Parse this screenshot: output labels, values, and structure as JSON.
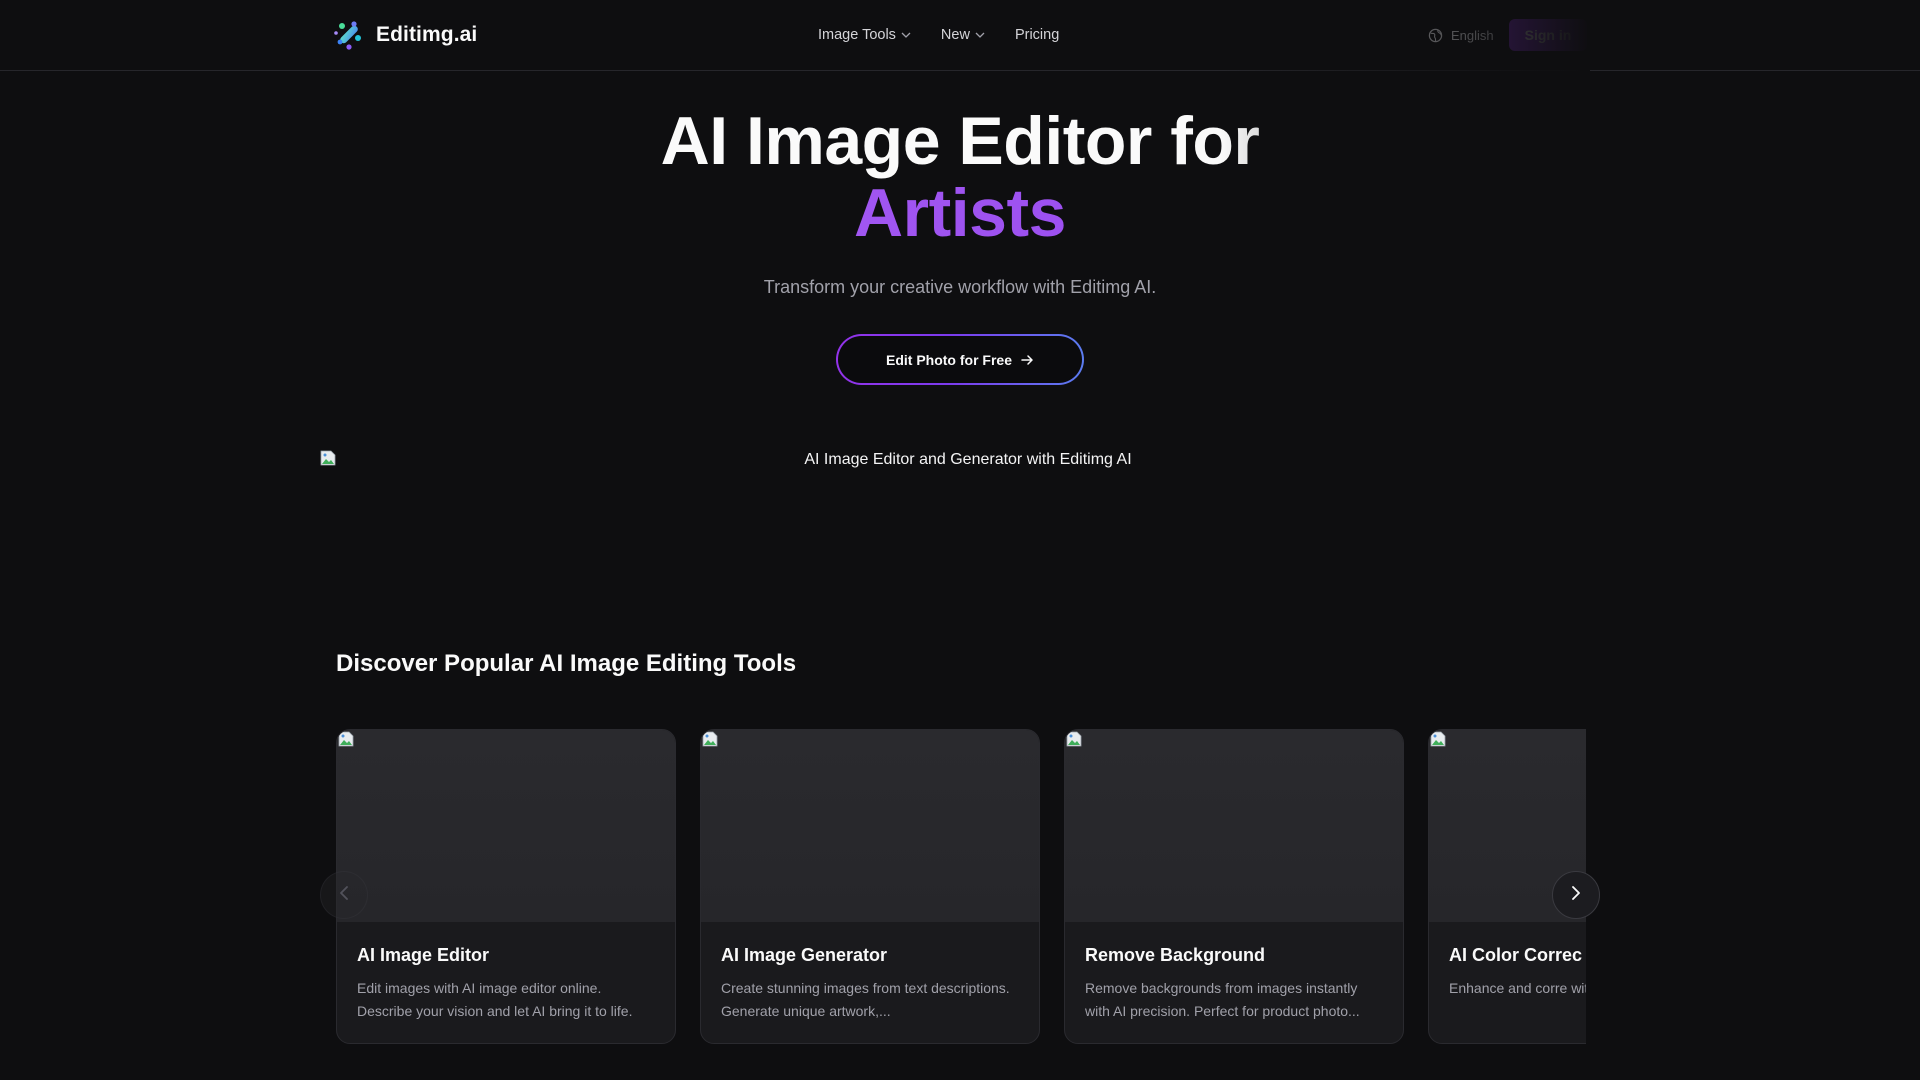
{
  "header": {
    "brand": "Editimg.ai",
    "logo_icon": "editimg-logo-icon",
    "nav": [
      {
        "label": "Image Tools",
        "has_dropdown": true
      },
      {
        "label": "New",
        "has_dropdown": true
      },
      {
        "label": "Pricing",
        "has_dropdown": false
      }
    ],
    "language": "English",
    "signin_label": "Sign in"
  },
  "hero": {
    "title_line1": "AI Image Editor for",
    "title_line2": "Artists",
    "subtitle": "Transform your creative workflow with Editimg AI.",
    "cta_label": "Edit Photo for Free",
    "image_alt": "AI Image Editor and Generator with Editimg AI"
  },
  "section": {
    "title": "Discover Popular AI Image Editing Tools"
  },
  "cards": [
    {
      "title": "AI Image Editor",
      "description": "Edit images with AI image editor online. Describe your vision and let AI bring it to life."
    },
    {
      "title": "AI Image Generator",
      "description": "Create stunning images from text descriptions. Generate unique artwork,..."
    },
    {
      "title": "Remove Background",
      "description": "Remove backgrounds from images instantly with AI precision. Perfect for product photo..."
    },
    {
      "title": "AI Color Correc",
      "description": "Enhance and corre with professional A"
    }
  ],
  "colors": {
    "background": "#0e0e10",
    "accent": "#9333ea",
    "cta_gradient_end": "#5b7cf0"
  }
}
